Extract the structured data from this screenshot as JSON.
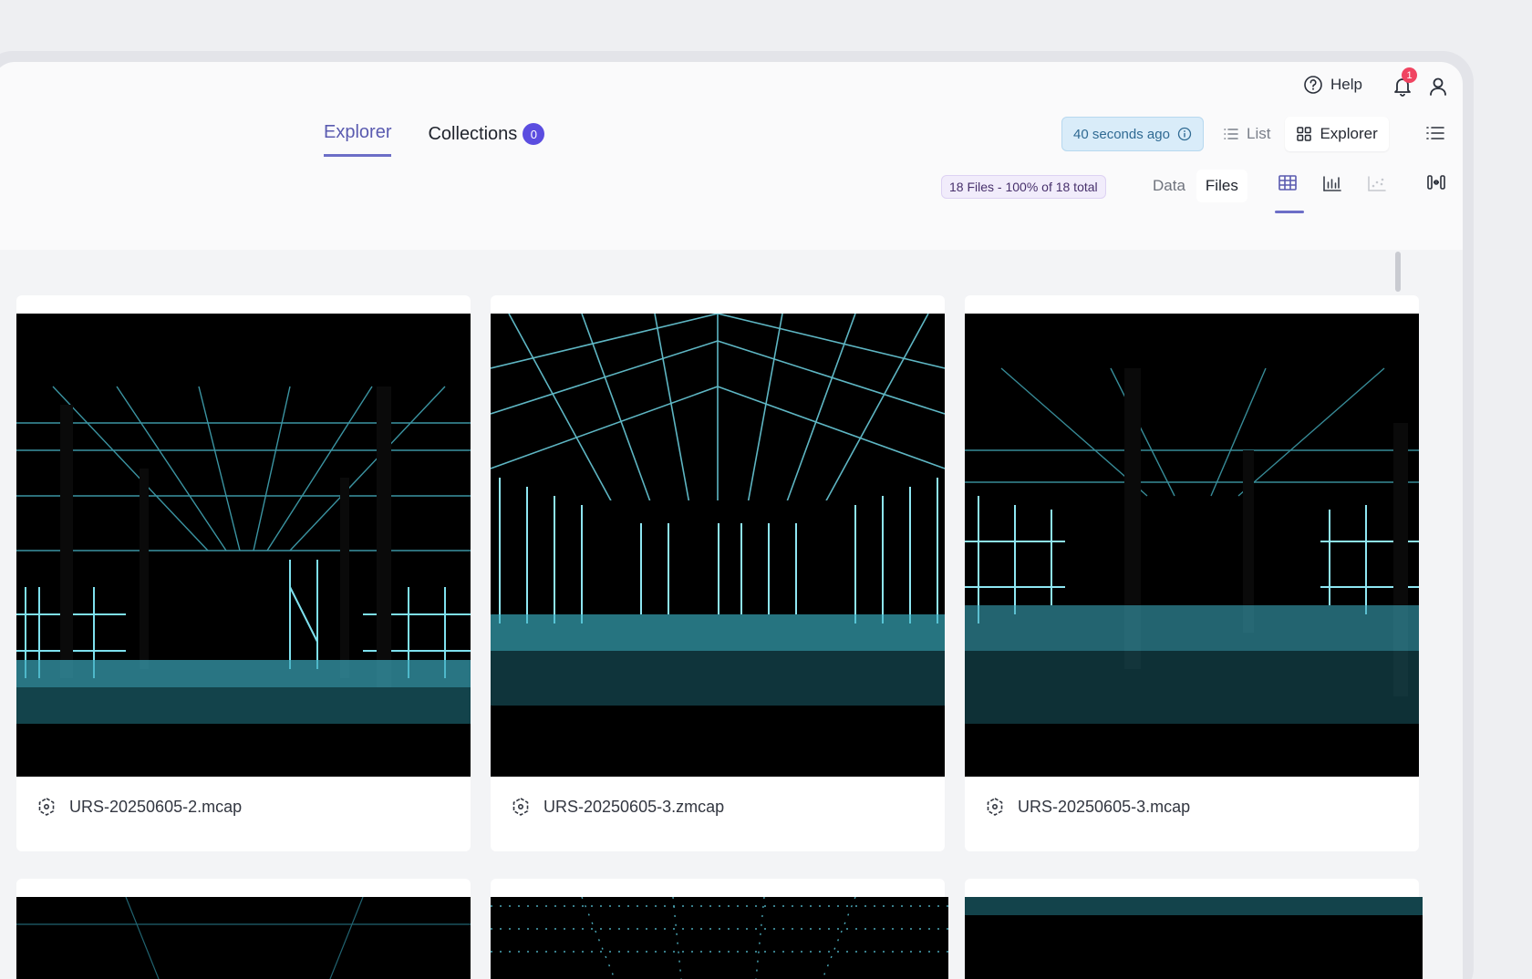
{
  "header": {
    "help_label": "Help",
    "notification_count": "1"
  },
  "tabs": [
    {
      "label": "Explorer",
      "active": true
    },
    {
      "label": "Collections",
      "badge": "0"
    }
  ],
  "toolbar": {
    "updated_label": "40 seconds ago",
    "view_options": [
      {
        "label": "List",
        "icon": "list-icon"
      },
      {
        "label": "Explorer",
        "icon": "grid-icon",
        "active": true
      }
    ],
    "files_summary": "18 Files - 100% of 18 total",
    "mode_options": [
      {
        "label": "Data"
      },
      {
        "label": "Files",
        "active": true
      }
    ],
    "viz_buttons": [
      "table-icon",
      "bar-chart-icon",
      "scatter-icon"
    ]
  },
  "files": [
    {
      "name": "URS-20250605-2.mcap"
    },
    {
      "name": "URS-20250605-3.zmcap"
    },
    {
      "name": "URS-20250605-3.mcap"
    },
    {
      "name": ""
    },
    {
      "name": ""
    },
    {
      "name": ""
    }
  ],
  "colors": {
    "accent": "#6c6ec7",
    "badge_purple": "#5b4de0",
    "notification_red": "#f04461",
    "pointcloud_cyan": "#5ed3e6"
  }
}
